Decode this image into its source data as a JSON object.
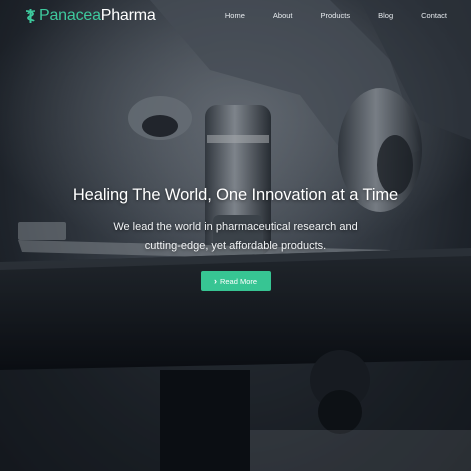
{
  "brand": {
    "name_part_1": "Panacea",
    "name_part_2": "Pharma",
    "accent_color": "#3ec99d",
    "icon": "caduceus-icon"
  },
  "nav": {
    "items": [
      {
        "label": "Home"
      },
      {
        "label": "About"
      },
      {
        "label": "Products"
      },
      {
        "label": "Blog"
      },
      {
        "label": "Contact"
      }
    ]
  },
  "hero": {
    "headline": "Healing The World, One Innovation at a Time",
    "subtext_line_1": "We lead the world in pharmaceutical research and",
    "subtext_line_2": "cutting-edge, yet affordable products.",
    "cta_label": "Read More",
    "cta_icon": "chevron-right-icon",
    "cta_color": "#37c593",
    "background_image": "microscope-photo"
  }
}
